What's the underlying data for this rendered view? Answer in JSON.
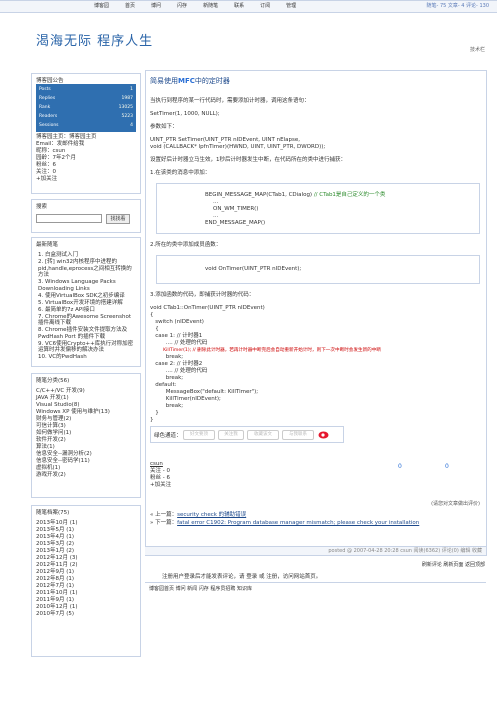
{
  "header": {
    "title": "渴海无际   程序人生",
    "subtitle": "技术栏"
  },
  "nav": {
    "items": [
      "博客园",
      "首页",
      "博问",
      "闪存",
      "新随笔",
      "联系",
      "订阅",
      "管理"
    ],
    "stats": "随笔- 75  文章- 4  评论- 130"
  },
  "announce": {
    "title": "博客园公告",
    "avatar_rows": [
      {
        "label": "Posts",
        "value": "1"
      },
      {
        "label": "Replies",
        "value": "1987"
      },
      {
        "label": "Rank",
        "value": "13025"
      },
      {
        "label": "Readers",
        "value": "5223"
      },
      {
        "label": "Sessions",
        "value": "4"
      }
    ],
    "lines": [
      "博客园主页：博客园主页",
      "Email：发邮件给我",
      "昵称：csun",
      "园龄：7年2个月",
      "粉丝：6",
      "关注：0",
      "+加关注"
    ]
  },
  "search": {
    "title": "搜索",
    "button": "找找看",
    "placeholder": ""
  },
  "latest": {
    "title": "最新随笔",
    "items": [
      "1. 白盒测试入门",
      "2. [转] win32内核程序中进程的pid,handle,eprocess之间相互转换的方法",
      "3. Windows Language Packs Downloading Links",
      "4. 使用VirtualBox SDK之初步编译",
      "5. VirtualBox开发环境的搭建详解",
      "6. 最简单的7z API接口",
      "7. Chrome的Awesome Screenshot插件离线下载",
      "8. Chrome插件安装文件提取方法及PwdHash Port 的插件下载",
      "9. VC6使用Crypto++库执行对称加密运算时并发偏移的解决办法",
      "10. VC的PwdHash"
    ]
  },
  "categories": {
    "title": "随笔分类(56)",
    "items": [
      "C/C++/VC 开发(9)",
      "JAVA 开发(1)",
      "Visual Studio(8)",
      "Windows XP 使用与维护(13)",
      "财务与管理(2)",
      "可信计算(3)",
      "如何做学问(1)",
      "软件开发(2)",
      "算法(1)",
      "信息安全--漏洞分析(2)",
      "信息安全--密码学(11)",
      "虚拟机(1)",
      "游戏开发(2)"
    ]
  },
  "archive": {
    "title": "随笔档案(75)",
    "items": [
      "2013年10月 (1)",
      "2013年5月 (1)",
      "2013年4月 (1)",
      "2013年3月 (2)",
      "2013年1月 (2)",
      "2012年12月 (3)",
      "2012年11月 (2)",
      "2012年9月 (1)",
      "2012年8月 (1)",
      "2012年7月 (1)",
      "2011年10月 (1)",
      "2011年9月 (1)",
      "2010年12月 (1)",
      "2010年7月 (5)"
    ]
  },
  "post": {
    "title_prefix": "简易使用",
    "title_bold": "MFC",
    "title_suffix": "中的定时器",
    "p1": "当执行到程序的某一行代码时，需要添加计时器，调用这条语句：",
    "p2": "SetTimer(1, 1000, NULL);",
    "p3": "参数如下：",
    "p4": "UINT_PTR SetTimer(UINT_PTR nIDEvent, UINT nElapse,",
    "p5": "   void (CALLBACK* lpfnTimer)(HWND, UINT, UINT_PTR, DWORD));",
    "p6": "设置好后计时器立马生效，1秒后计时器发生中断，在代码所在的类中进行捕获：",
    "p7": "1.在该类的消息中添加：",
    "box1": [
      "BEGIN_MESSAGE_MAP(CTab1, CDialog)",
      "...",
      "ON_WM_TIMER()",
      "...",
      "END_MESSAGE_MAP()"
    ],
    "box1_comment": "// CTab1是自己定义的一个类",
    "p8": "2.所在的类中添加成员函数：",
    "box2": "void OnTimer(UINT_PTR nIDEvent);",
    "p9": "3.添加函数的代码，即捕获计时器的代码：",
    "code": [
      "void CTab1::OnTimer(UINT_PTR nIDEvent)",
      "{",
      "   switch (nIDEvent)",
      "   {",
      "   case 1: // 计时器1",
      "         .... // 处理的代码",
      "         KillTimer(1); // 删除此计时器，若再计时器中断完后会自动重新开始计时，则下一次中断时会发生新的中断",
      "         break;",
      "   case 2: // 计时器2",
      "         .... // 处理的代码",
      "         break;",
      "   default:",
      "         MessageBox(\"default: KillTimer\");",
      "         KillTimer(nIDEvent);",
      "         break;",
      "   }",
      "}"
    ]
  },
  "share": {
    "label": "绿色通道：",
    "buttons": [
      "好文要顶",
      "关注我",
      "收藏该文",
      "与我联系"
    ]
  },
  "author": {
    "name": "csun",
    "focus": "关注 - 0",
    "fans": "粉丝 - 6",
    "follow": "+加关注",
    "up": "0",
    "down": "0"
  },
  "related_note": "(请您对文章做出评价)",
  "prevnext": {
    "prev_label": "« 上一篇：",
    "prev": "security check 的辅助错误",
    "next_label": "» 下一篇：",
    "next": "fatal error C1902: Program database manager mismatch; please check your installation"
  },
  "footer": {
    "posted": "posted @ 2007-04-28 20:28 csun 阅读(6362) 评论(0) 编辑 收藏"
  },
  "actions": {
    "text": "刷新评论  刷新页面  返回顶部"
  },
  "login_tip": "注册用户登录后才能发表评论，请 登录 或 注册，访问网站首页。",
  "bottom_nav": "博客园首页   博问   新闻   闪存   程序员招聘   知识库",
  "colors": {
    "accent": "#2a64a8",
    "border": "#c8d3e6",
    "avatar_bg": "#2f6fb0"
  }
}
